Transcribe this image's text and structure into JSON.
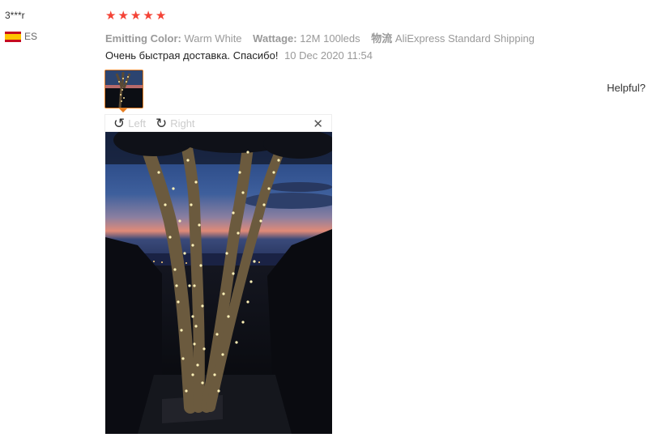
{
  "reviewer": {
    "name": "3***r",
    "country_code": "ES",
    "flag": "spain-flag-icon"
  },
  "review": {
    "stars": [
      "★",
      "★",
      "★",
      "★",
      "★"
    ],
    "rating": 5,
    "attributes": [
      {
        "key": "Emitting Color:",
        "value": "Warm White"
      },
      {
        "key": "Wattage:",
        "value": "12M 100leds"
      },
      {
        "key": "物流",
        "value": "AliExpress Standard Shipping"
      }
    ],
    "text": "Очень быстрая доставка. Спасибо!",
    "date": "10 Dec 2020 11:54"
  },
  "helpful_label": "Helpful?",
  "viewer": {
    "rotate_left_label": "Left",
    "rotate_right_label": "Right",
    "rotate_left_icon": "↺",
    "rotate_right_icon": "↻",
    "close_icon": "✕"
  },
  "colors": {
    "star": "#f44336",
    "thumb_border": "#e67e22"
  }
}
